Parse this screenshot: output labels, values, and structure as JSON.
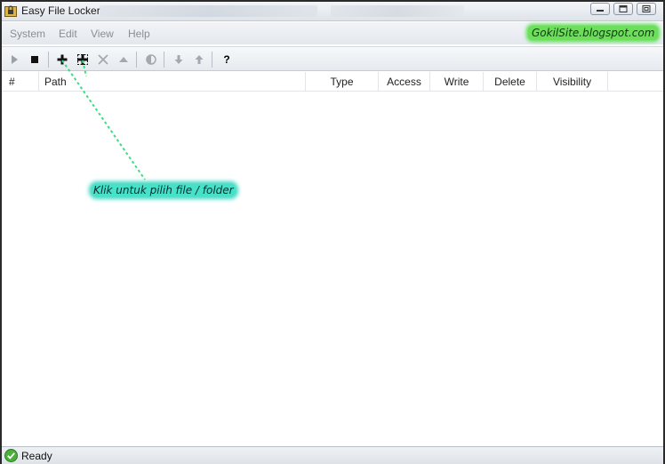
{
  "window": {
    "title": "Easy File Locker"
  },
  "menu": {
    "items": [
      "System",
      "Edit",
      "View",
      "Help"
    ]
  },
  "watermark": "GokilSite.blogspot.com",
  "toolbar": {
    "buttons": [
      "play-icon",
      "stop-icon",
      "add-file-icon",
      "add-folder-icon",
      "delete-icon",
      "eject-icon",
      "half-circle-icon",
      "move-down-icon",
      "move-up-icon"
    ],
    "help_label": "?"
  },
  "table": {
    "columns": [
      "#",
      "Path",
      "Type",
      "Access",
      "Write",
      "Delete",
      "Visibility"
    ],
    "rows": []
  },
  "annotation": {
    "text": "Klik untuk pilih file / folder"
  },
  "status": {
    "text": "Ready"
  },
  "colors": {
    "watermark_bg": "#6dde5a",
    "callout_bg": "#47e0c8",
    "arrow": "#3ddc84"
  }
}
